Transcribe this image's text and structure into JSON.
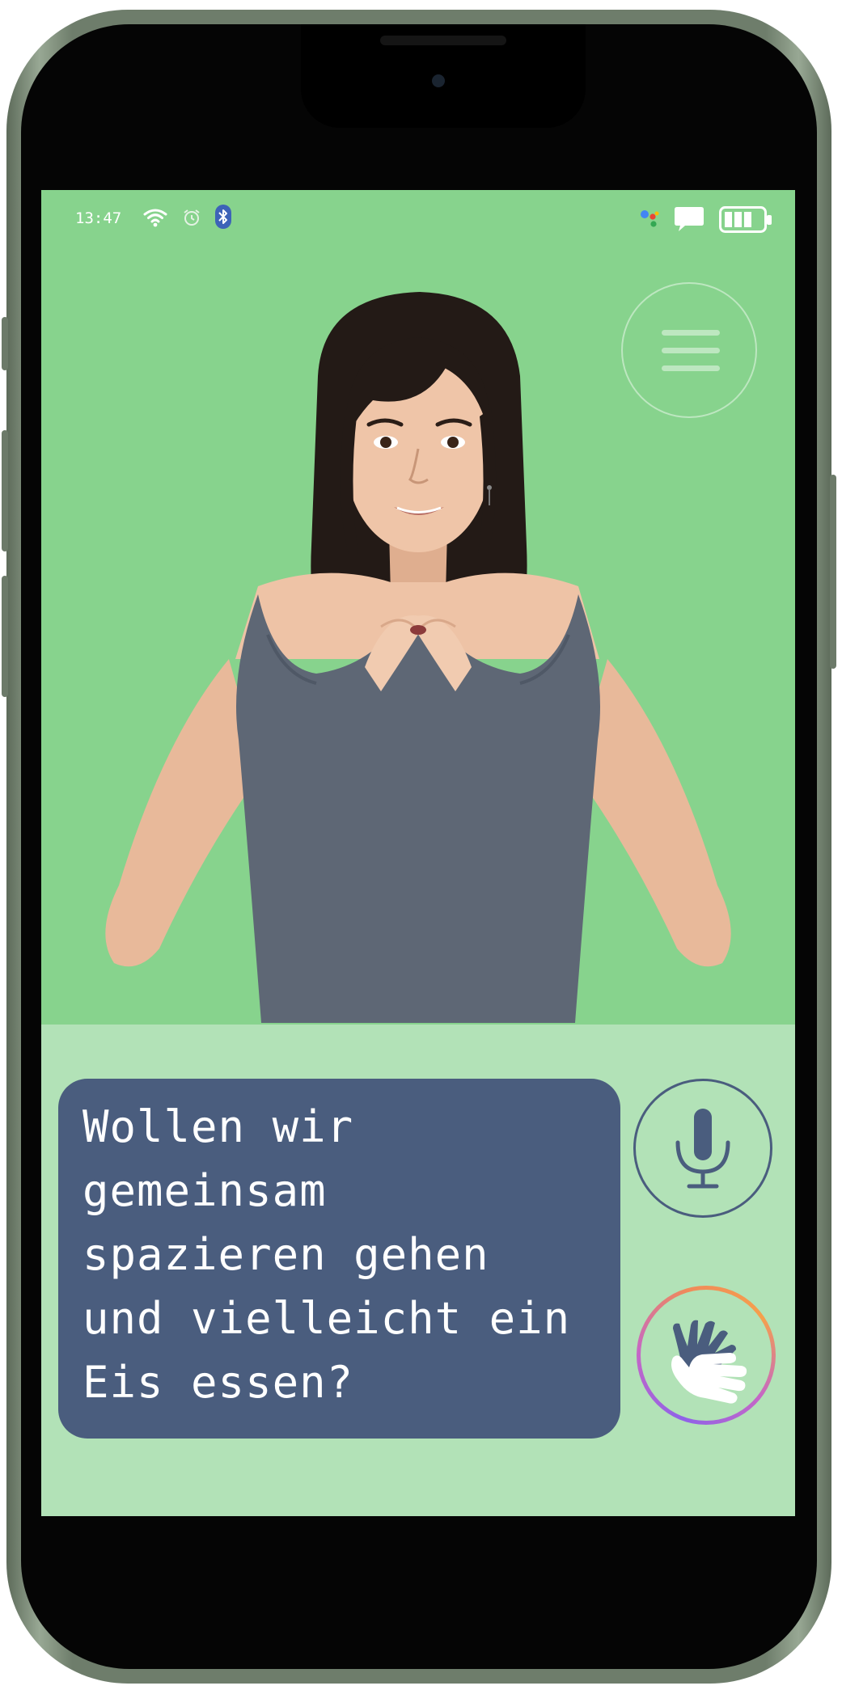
{
  "status_bar": {
    "time": "13:47",
    "icons": [
      "wifi-icon",
      "alarm-icon",
      "bluetooth-icon",
      "assistant-icon",
      "message-icon",
      "battery-icon"
    ]
  },
  "menu": {
    "icon": "hamburger-menu-icon"
  },
  "message": {
    "text": "Wollen wir\ngemeinsam\nspazieren gehen\nund vielleicht ein\nEis essen?"
  },
  "actions": {
    "microphone_icon": "microphone-icon",
    "sign_language_icon": "sign-language-hands-icon"
  },
  "colors": {
    "screen_background": "#87d38d",
    "panel_background": "#b2e2b7",
    "bubble": "#4a5d7e",
    "accent": "#4a5d7e"
  }
}
